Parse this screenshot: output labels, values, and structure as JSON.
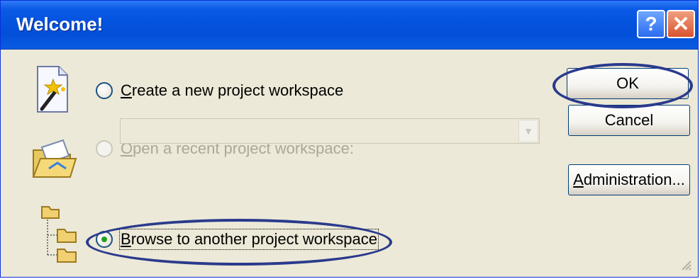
{
  "window": {
    "title": "Welcome!"
  },
  "titlebar_buttons": {
    "help_label": "?",
    "close_label": "✕"
  },
  "options": {
    "create_new": {
      "prefix": "C",
      "rest": "reate a new project workspace",
      "selected": false,
      "enabled": true,
      "icon": "wizard-document-icon"
    },
    "open_recent": {
      "prefix": "O",
      "rest": "pen a recent project workspace:",
      "selected": false,
      "enabled": false,
      "icon": "open-folder-icon",
      "combo_value": ""
    },
    "browse": {
      "prefix": "B",
      "rest": "rowse to another project workspace",
      "selected": true,
      "enabled": true,
      "icon": "folder-tree-icon"
    }
  },
  "buttons": {
    "ok_label": "OK",
    "cancel_label": "Cancel",
    "admin_prefix": "A",
    "admin_rest": "dministration..."
  },
  "colors": {
    "titlebar": "#0453de",
    "face": "#ece9d8",
    "annotation": "#2a3a8c",
    "radio_dot": "#21a121"
  }
}
